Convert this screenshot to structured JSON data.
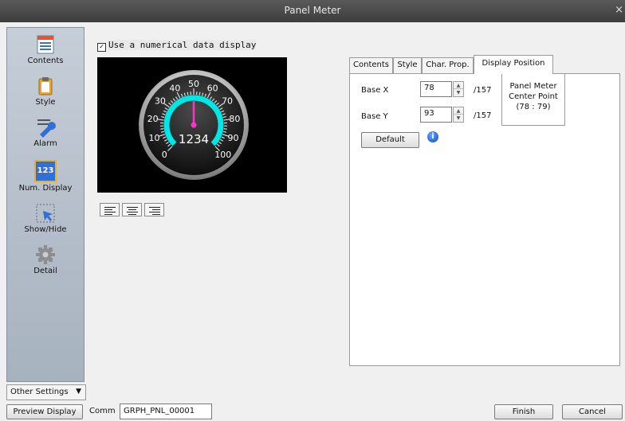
{
  "window": {
    "title": "Panel Meter",
    "close_label": "×"
  },
  "sidebar": {
    "items": [
      {
        "label": "Contents",
        "icon": "contents-icon"
      },
      {
        "label": "Style",
        "icon": "clipboard-icon"
      },
      {
        "label": "Alarm",
        "icon": "wrench-icon"
      },
      {
        "label": "Num. Display",
        "icon": "num-display-icon",
        "icon_text": "123",
        "selected": true
      },
      {
        "label": "Show/Hide",
        "icon": "cursor-select-icon"
      },
      {
        "label": "Detail",
        "icon": "gear-icon"
      }
    ],
    "other_settings_label": "Other Settings"
  },
  "main": {
    "checkbox_label": "Use a numerical data display",
    "checkbox_checked": true,
    "gauge": {
      "value_display": "1234",
      "scale_labels": [
        "0",
        "10",
        "20",
        "30",
        "40",
        "50",
        "60",
        "70",
        "80",
        "90",
        "100"
      ],
      "needle_value": 50,
      "arc_color": "#00e5e5",
      "needle_color": "#ff33cc"
    },
    "align_buttons": [
      "align-left",
      "align-center",
      "align-right"
    ]
  },
  "tabs": [
    "Contents",
    "Style",
    "Char. Prop.",
    "Display Position"
  ],
  "active_tab": "Display Position",
  "display_position": {
    "base_x_label": "Base X",
    "base_x_value": "78",
    "base_x_max": "/157",
    "base_y_label": "Base Y",
    "base_y_value": "93",
    "base_y_max": "/157",
    "default_button": "Default",
    "center_point": {
      "line1": "Panel Meter",
      "line2": "Center Point",
      "line3": "(78 : 79)"
    }
  },
  "bottom": {
    "preview_button": "Preview Display",
    "comm_label": "Comm",
    "comm_value": "GRPH_PNL_00001",
    "finish_button": "Finish",
    "cancel_button": "Cancel"
  },
  "colors": {
    "titlebar": "#4a4a4a",
    "sidebar": "#b8c1cd",
    "accent": "#00e5e5"
  }
}
